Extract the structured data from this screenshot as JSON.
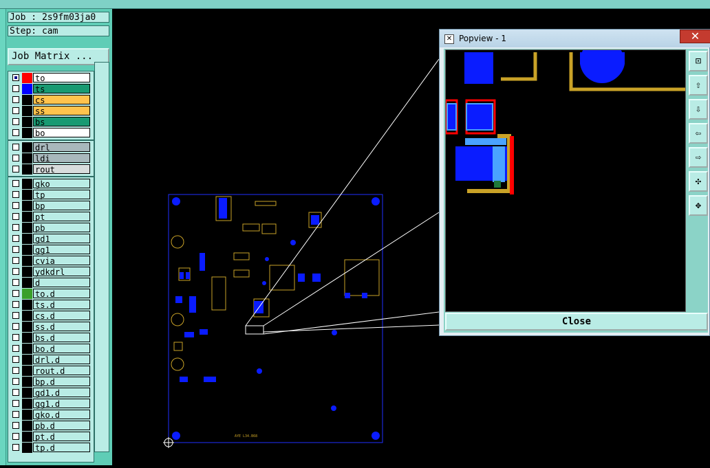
{
  "job": "Job : 2s9fm03ja0",
  "step": "Step: cam",
  "job_matrix_button": "Job Matrix ...",
  "layers_group1": [
    {
      "name": "to",
      "color": "#ff0000",
      "bg": "#ffffff",
      "checked": true
    },
    {
      "name": "ts",
      "color": "#0000ff",
      "bg": "#199a72",
      "checked": false
    },
    {
      "name": "cs",
      "color": "#000000",
      "bg": "#ffc34d",
      "checked": false
    },
    {
      "name": "ss",
      "color": "#000000",
      "bg": "#ffc34d",
      "checked": false
    },
    {
      "name": "bs",
      "color": "#000000",
      "bg": "#199a72",
      "checked": false
    },
    {
      "name": "bo",
      "color": "#000000",
      "bg": "#ffffff",
      "checked": false
    }
  ],
  "layers_group2": [
    {
      "name": "drl",
      "bg": "#a8b8bc"
    },
    {
      "name": "ldi",
      "bg": "#a8b8bc"
    },
    {
      "name": "rout",
      "bg": "#d8dcdc"
    }
  ],
  "layers_group3": [
    {
      "name": "gko",
      "sw": "#000000"
    },
    {
      "name": "tp",
      "sw": "#000000"
    },
    {
      "name": "bp",
      "sw": "#000000"
    },
    {
      "name": "pt",
      "sw": "#000000"
    },
    {
      "name": "pb",
      "sw": "#000000"
    },
    {
      "name": "gd1",
      "sw": "#000000"
    },
    {
      "name": "gg1",
      "sw": "#000000"
    },
    {
      "name": "cvia",
      "sw": "#000000"
    },
    {
      "name": "ydkdrl",
      "sw": "#000000"
    },
    {
      "name": "d",
      "sw": "#000000"
    },
    {
      "name": "to.d",
      "sw": "#3aa02a"
    },
    {
      "name": "ts.d",
      "sw": "#000000"
    },
    {
      "name": "cs.d",
      "sw": "#000000"
    },
    {
      "name": "ss.d",
      "sw": "#000000"
    },
    {
      "name": "bs.d",
      "sw": "#000000"
    },
    {
      "name": "bo.d",
      "sw": "#000000"
    },
    {
      "name": "drl.d",
      "sw": "#000000"
    },
    {
      "name": "rout.d",
      "sw": "#000000"
    },
    {
      "name": "bp.d",
      "sw": "#000000"
    },
    {
      "name": "gd1.d",
      "sw": "#000000"
    },
    {
      "name": "gg1.d",
      "sw": "#000000"
    },
    {
      "name": "gko.d",
      "sw": "#000000"
    },
    {
      "name": "pb.d",
      "sw": "#000000"
    },
    {
      "name": "pt.d",
      "sw": "#000000"
    },
    {
      "name": "tp.d",
      "sw": "#000000"
    }
  ],
  "popup": {
    "title": "Popview - 1",
    "close_x": "✕",
    "close_label": "Close",
    "tool_icons": [
      "zoom-fit-icon",
      "pan-up-icon",
      "pan-down-icon",
      "pan-left-icon",
      "pan-right-icon",
      "zoom-in-icon",
      "zoom-out-icon"
    ]
  },
  "board_label": "AYE L34.B68",
  "colors": {
    "copper": "#0000ff",
    "silk": "#c9a227",
    "outline": "#2030ff"
  }
}
